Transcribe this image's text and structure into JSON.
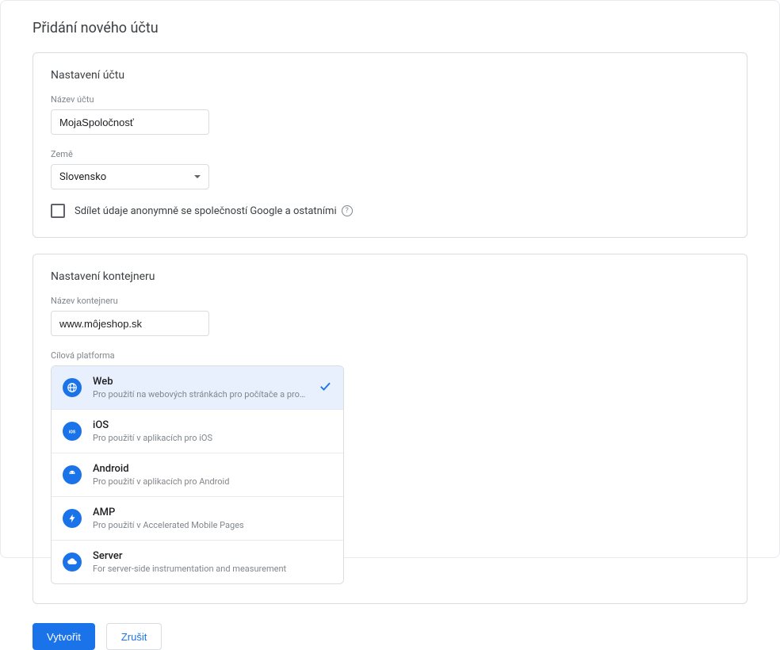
{
  "pageTitle": "Přidání nového účtu",
  "account": {
    "panelTitle": "Nastavení účtu",
    "nameLabel": "Název účtu",
    "nameValue": "MojaSpoločnosť",
    "countryLabel": "Země",
    "countryValue": "Slovensko",
    "shareLabel": "Sdílet údaje anonymně se společností Google a ostatními"
  },
  "container": {
    "panelTitle": "Nastavení kontejneru",
    "nameLabel": "Název kontejneru",
    "nameValue": "www.môjeshop.sk",
    "platformLabel": "Cílová platforma",
    "platforms": [
      {
        "title": "Web",
        "desc": "Pro použití na webových stránkách pro počítače a pro …",
        "selected": true,
        "icon": "globe"
      },
      {
        "title": "iOS",
        "desc": "Pro použití v aplikacích pro iOS",
        "selected": false,
        "icon": "ios"
      },
      {
        "title": "Android",
        "desc": "Pro použití v aplikacích pro Android",
        "selected": false,
        "icon": "android"
      },
      {
        "title": "AMP",
        "desc": "Pro použití v Accelerated Mobile Pages",
        "selected": false,
        "icon": "amp"
      },
      {
        "title": "Server",
        "desc": "For server-side instrumentation and measurement",
        "selected": false,
        "icon": "server"
      }
    ]
  },
  "buttons": {
    "create": "Vytvořit",
    "cancel": "Zrušit"
  }
}
